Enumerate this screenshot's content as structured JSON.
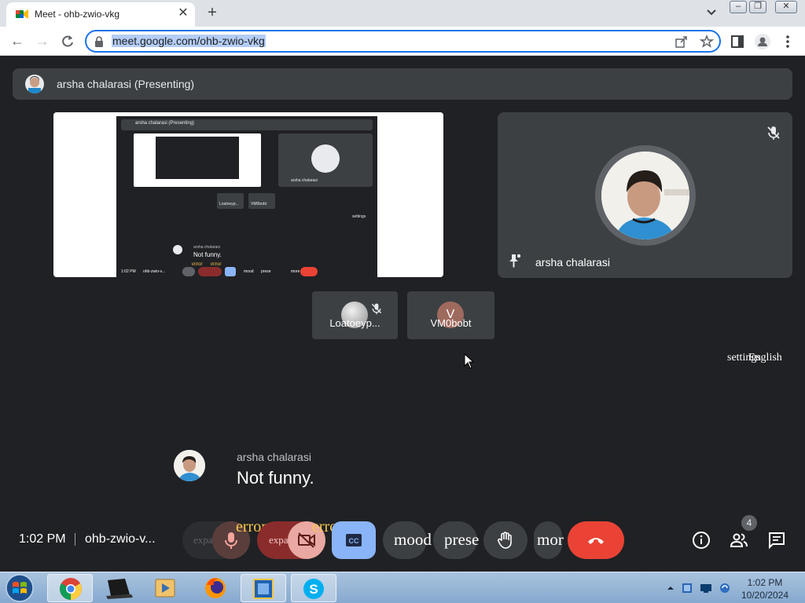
{
  "browser": {
    "tab_title": "Meet - ohb-zwio-vkg",
    "tab_close": "✕",
    "new_tab": "+",
    "url": "meet.google.com/ohb-zwio-vkg"
  },
  "meet": {
    "presenting_label": "arsha chalarasi (Presenting)",
    "share_preview": {
      "presenting_label": "arsha chalarasi (Presenting)",
      "tile_name": "arsha chalarasi",
      "caption_name": "arsha chalarasi",
      "caption_text": "Not funny.",
      "settings_text": "settings",
      "tile_a": "Loatoeyp...",
      "tile_b": "VM0bobt",
      "bar_clock": "1:02 PM",
      "bar_code": "ohb-zwio-v...",
      "bar_labels": [
        "error",
        "error",
        "mood",
        "prese",
        "more"
      ]
    },
    "main_participant": {
      "name": "arsha chalarasi"
    },
    "tiles": [
      {
        "name": "Loatoeyp..."
      },
      {
        "name": "VM0bobt",
        "initial": "V"
      }
    ],
    "overlay_settings": "settings",
    "overlay_language": "English",
    "caption": {
      "speaker": "arsha chalarasi",
      "text": "Not funny."
    },
    "bottom": {
      "time": "1:02 PM",
      "code": "ohb-zwio-v...",
      "mic_error": "error",
      "cam_error": "error",
      "expand_left": "expand_less",
      "expand_cam": "expand_less",
      "mood_label": "mood",
      "present_label": "prese",
      "more_label": "mor",
      "people_count": "4"
    }
  },
  "taskbar": {
    "time": "1:02 PM",
    "date": "10/20/2024"
  },
  "colors": {
    "background": "#202124",
    "tile": "#3c4043",
    "end_call": "#ea4335",
    "captions_active": "#8ab4f8",
    "accent": "#1a73e8"
  }
}
